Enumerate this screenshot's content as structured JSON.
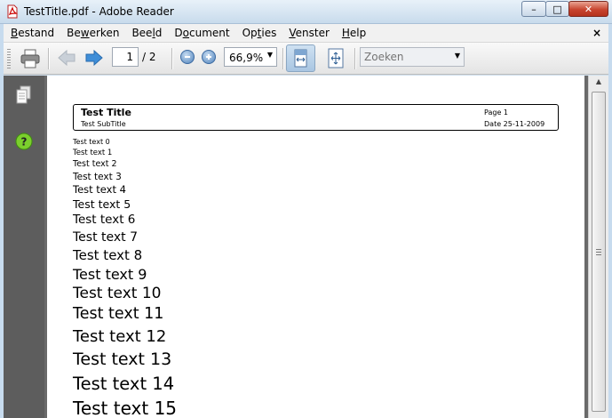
{
  "window": {
    "title": "TestTitle.pdf - Adobe Reader",
    "minimize_symbol": "–",
    "maximize_symbol": "□",
    "close_symbol": "✕"
  },
  "menubar": {
    "items": [
      {
        "label": "Bestand",
        "mnemonic": "B"
      },
      {
        "label": "Bewerken",
        "mnemonic": "w"
      },
      {
        "label": "Beeld",
        "mnemonic": "l"
      },
      {
        "label": "Document",
        "mnemonic": "o"
      },
      {
        "label": "Opties",
        "mnemonic": "t"
      },
      {
        "label": "Venster",
        "mnemonic": "V"
      },
      {
        "label": "Help",
        "mnemonic": "H"
      }
    ],
    "close_label": "×"
  },
  "toolbar": {
    "current_page": "1",
    "page_total": "/ 2",
    "zoom_value": "66,9%",
    "search_placeholder": "Zoeken"
  },
  "icons": {
    "print": "printer-icon",
    "prev": "previous-page-icon",
    "next": "next-page-icon",
    "zoom_out": "zoom-out-icon",
    "zoom_in": "zoom-in-icon",
    "fit_width": "fit-width-icon",
    "fit_page": "fit-page-icon",
    "pages": "pages-icon",
    "help": "help-icon"
  },
  "document": {
    "header": {
      "title": "Test Title",
      "subtitle": "Test SubTitle",
      "page": "Page 1",
      "date": "Date 25-11-2009"
    },
    "lines": [
      "Test text 0",
      "Test text 1",
      "Test text 2",
      "Test text 3",
      "Test text 4",
      "Test text 5",
      "Test text 6",
      "Test text 7",
      "Test text 8",
      "Test text 9",
      "Test text 10",
      "Test text 11",
      "Test text 12",
      "Test text 13",
      "Test text 14",
      "Test text 15"
    ]
  }
}
